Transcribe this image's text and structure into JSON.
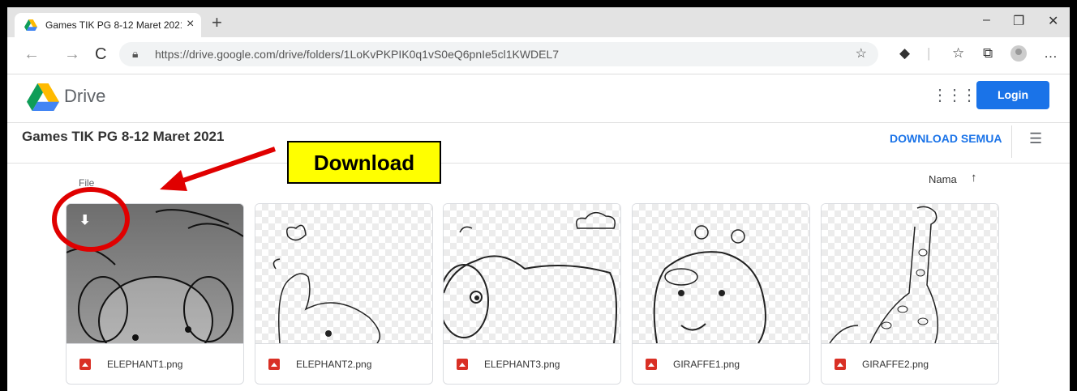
{
  "browser": {
    "tab_title": "Games TIK PG 8-12 Maret 2021 -",
    "tab_close": "×",
    "new_tab": "+",
    "url": "https://drive.google.com/drive/folders/1LoKvPKPIK0q1vS0eQ6pnIe5cl1KWDEL7",
    "window_controls": {
      "minimize": "–",
      "restore": "❐",
      "close": "✕"
    },
    "nav": {
      "back": "←",
      "forward": "→",
      "reload": "C"
    },
    "toolbar_icons": {
      "star": "☆",
      "collections": "⧉",
      "menu": "…"
    }
  },
  "drive": {
    "app_name": "Drive",
    "login_label": "Login",
    "folder_title": "Games TIK PG 8-12 Maret 2021",
    "download_all_label": "DOWNLOAD SEMUA",
    "section_label": "File",
    "sort_label": "Nama",
    "sort_arrow": "↑",
    "files": [
      {
        "name": "ELEPHANT1.png"
      },
      {
        "name": "ELEPHANT2.png"
      },
      {
        "name": "ELEPHANT3.png"
      },
      {
        "name": "GIRAFFE1.png"
      },
      {
        "name": "GIRAFFE2.png"
      }
    ]
  },
  "annotation": {
    "label": "Download",
    "label_bg": "#ffff00",
    "highlight_color": "#e00000"
  },
  "colors": {
    "accent": "#1a73e8"
  }
}
